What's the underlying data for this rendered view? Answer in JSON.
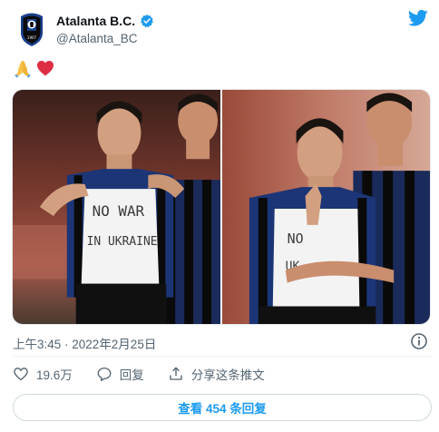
{
  "tweet": {
    "display_name": "Atalanta B.C.",
    "handle": "@Atalanta_BC",
    "emojis": [
      "folded-hands",
      "red-heart"
    ],
    "timestamp": "上午3:45 · 2022年2月25日",
    "photos": [
      {
        "shirt_text_lines": [
          "NO WAR",
          "IN UKRAINE"
        ]
      },
      {
        "shirt_text_lines": [
          "NO",
          "UK"
        ]
      }
    ]
  },
  "actions": {
    "like_count": "19.6万",
    "reply_label": "回复",
    "share_label": "分享这条推文"
  },
  "replies_button": {
    "label": "查看 454 条回复"
  },
  "colors": {
    "accent": "#1d9bf0",
    "like": "#536471",
    "text": "#0f1419",
    "muted": "#536471"
  }
}
